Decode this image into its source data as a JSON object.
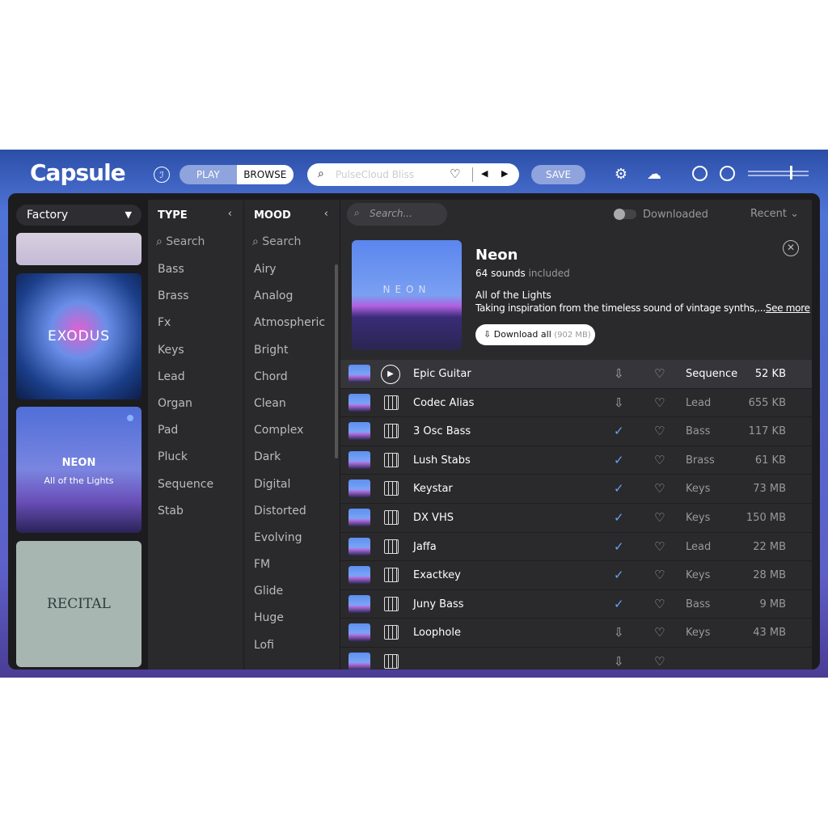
{
  "app": {
    "logo": "Capsule",
    "mode_tabs": [
      {
        "label": "PLAY",
        "active": false
      },
      {
        "label": "BROWSE",
        "active": true
      }
    ],
    "search_placeholder": "PulseCloud Bliss",
    "save_label": "SAVE"
  },
  "library": {
    "selected": "Factory",
    "cards": [
      {
        "title": "EXODUS"
      },
      {
        "title": "NEON",
        "subtitle": "All of the Lights"
      },
      {
        "title": "RECITAL"
      }
    ]
  },
  "type_filter": {
    "header": "TYPE",
    "search": "Search",
    "items": [
      "Bass",
      "Brass",
      "Fx",
      "Keys",
      "Lead",
      "Organ",
      "Pad",
      "Pluck",
      "Sequence",
      "Stab"
    ]
  },
  "mood_filter": {
    "header": "MOOD",
    "search": "Search",
    "items": [
      "Airy",
      "Analog",
      "Atmospheric",
      "Bright",
      "Chord",
      "Clean",
      "Complex",
      "Dark",
      "Digital",
      "Distorted",
      "Evolving",
      "FM",
      "Glide",
      "Huge",
      "Lofi"
    ]
  },
  "main": {
    "search_placeholder": "Search...",
    "downloaded_toggle": "Downloaded",
    "downloaded_on": false,
    "sort": "Recent",
    "pack": {
      "name": "Neon",
      "art_text": "NEON",
      "count": "64 sounds",
      "count_suffix": "included",
      "subtitle": "All of the Lights",
      "description": "Taking inspiration from the timeless sound of vintage synths,...",
      "see_more": "See more",
      "download_label": "Download all",
      "download_size": "(902 MB)"
    },
    "sounds": [
      {
        "name": "Epic Guitar",
        "status": "download",
        "type": "Sequence",
        "size": "52 KB",
        "playing": true
      },
      {
        "name": "Codec Alias",
        "status": "download",
        "type": "Lead",
        "size": "655 KB"
      },
      {
        "name": "3 Osc Bass",
        "status": "downloaded",
        "type": "Bass",
        "size": "117 KB"
      },
      {
        "name": "Lush Stabs",
        "status": "downloaded",
        "type": "Brass",
        "size": "61 KB"
      },
      {
        "name": "Keystar",
        "status": "downloaded",
        "type": "Keys",
        "size": "73 MB"
      },
      {
        "name": "DX VHS",
        "status": "downloaded",
        "type": "Keys",
        "size": "150 MB"
      },
      {
        "name": "Jaffa",
        "status": "downloaded",
        "type": "Lead",
        "size": "22 MB"
      },
      {
        "name": "Exactkey",
        "status": "downloaded",
        "type": "Keys",
        "size": "28 MB"
      },
      {
        "name": "Juny Bass",
        "status": "downloaded",
        "type": "Bass",
        "size": "9 MB"
      },
      {
        "name": "Loophole",
        "status": "download",
        "type": "Keys",
        "size": "43 MB"
      }
    ]
  },
  "colors": {
    "accent": "#5b8def",
    "check": "#6aa2f5"
  }
}
